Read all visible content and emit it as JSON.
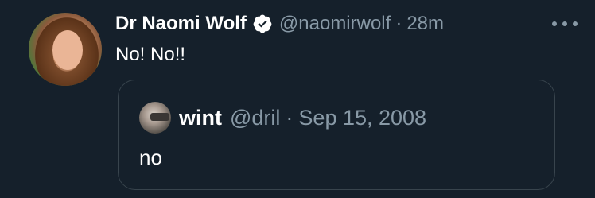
{
  "tweet": {
    "display_name": "Dr Naomi Wolf",
    "handle": "@naomirwolf",
    "separator": "·",
    "time": "28m",
    "text": "No! No!!",
    "verified_icon": "verified-badge-icon",
    "more_icon": "more-options-icon"
  },
  "quoted_tweet": {
    "display_name": "wint",
    "handle": "@dril",
    "separator": "·",
    "date": "Sep 15, 2008",
    "text": "no"
  },
  "colors": {
    "background": "#15202b",
    "primary_text": "#ffffff",
    "secondary_text": "#8899a6",
    "border": "#38444d"
  }
}
